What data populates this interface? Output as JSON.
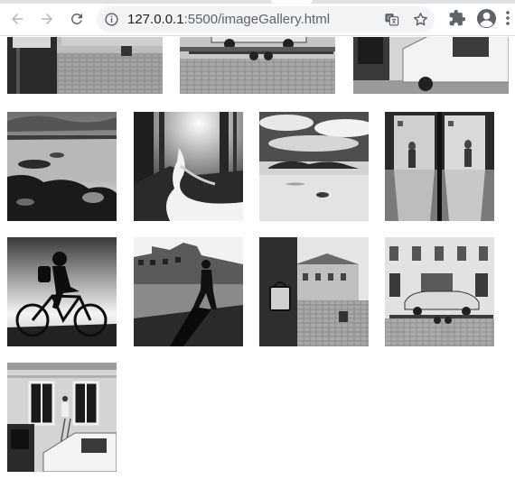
{
  "browser": {
    "url_host": "127.0.0.1",
    "url_path": ":5500/imageGallery.html",
    "icons": {
      "back": "arrow-left-icon",
      "forward": "arrow-right-icon",
      "reload": "reload-icon",
      "site_info": "info-icon",
      "translate": "translate-icon",
      "bookmark": "star-icon",
      "extensions": "puzzle-icon",
      "profile": "account-icon",
      "menu": "kebab-menu-icon"
    }
  },
  "gallery": {
    "style": "black-and-white",
    "images": [
      {
        "subject": "portable toilet on cobblestone street"
      },
      {
        "subject": "vintage car on trailer"
      },
      {
        "subject": "white van and portable toilet"
      },
      {
        "subject": "rocky lake shore under clouds"
      },
      {
        "subject": "forest waterfall"
      },
      {
        "subject": "beach with distant island"
      },
      {
        "subject": "shop window with fashion posters"
      },
      {
        "subject": "cyclist silhouette"
      },
      {
        "subject": "pedestrian silhouette on sunny square"
      },
      {
        "subject": "portable toilet in old town"
      },
      {
        "subject": "vintage car on trailer in front of building"
      },
      {
        "subject": "building facade, man on ladder and van"
      }
    ]
  },
  "colors": {
    "toolbar_bg": "#ffffff",
    "omnibox_bg": "#f1f3f4",
    "icon_gray": "#5f6368",
    "icon_disabled": "#b4b6b9",
    "page_bg": "#ffffff"
  }
}
